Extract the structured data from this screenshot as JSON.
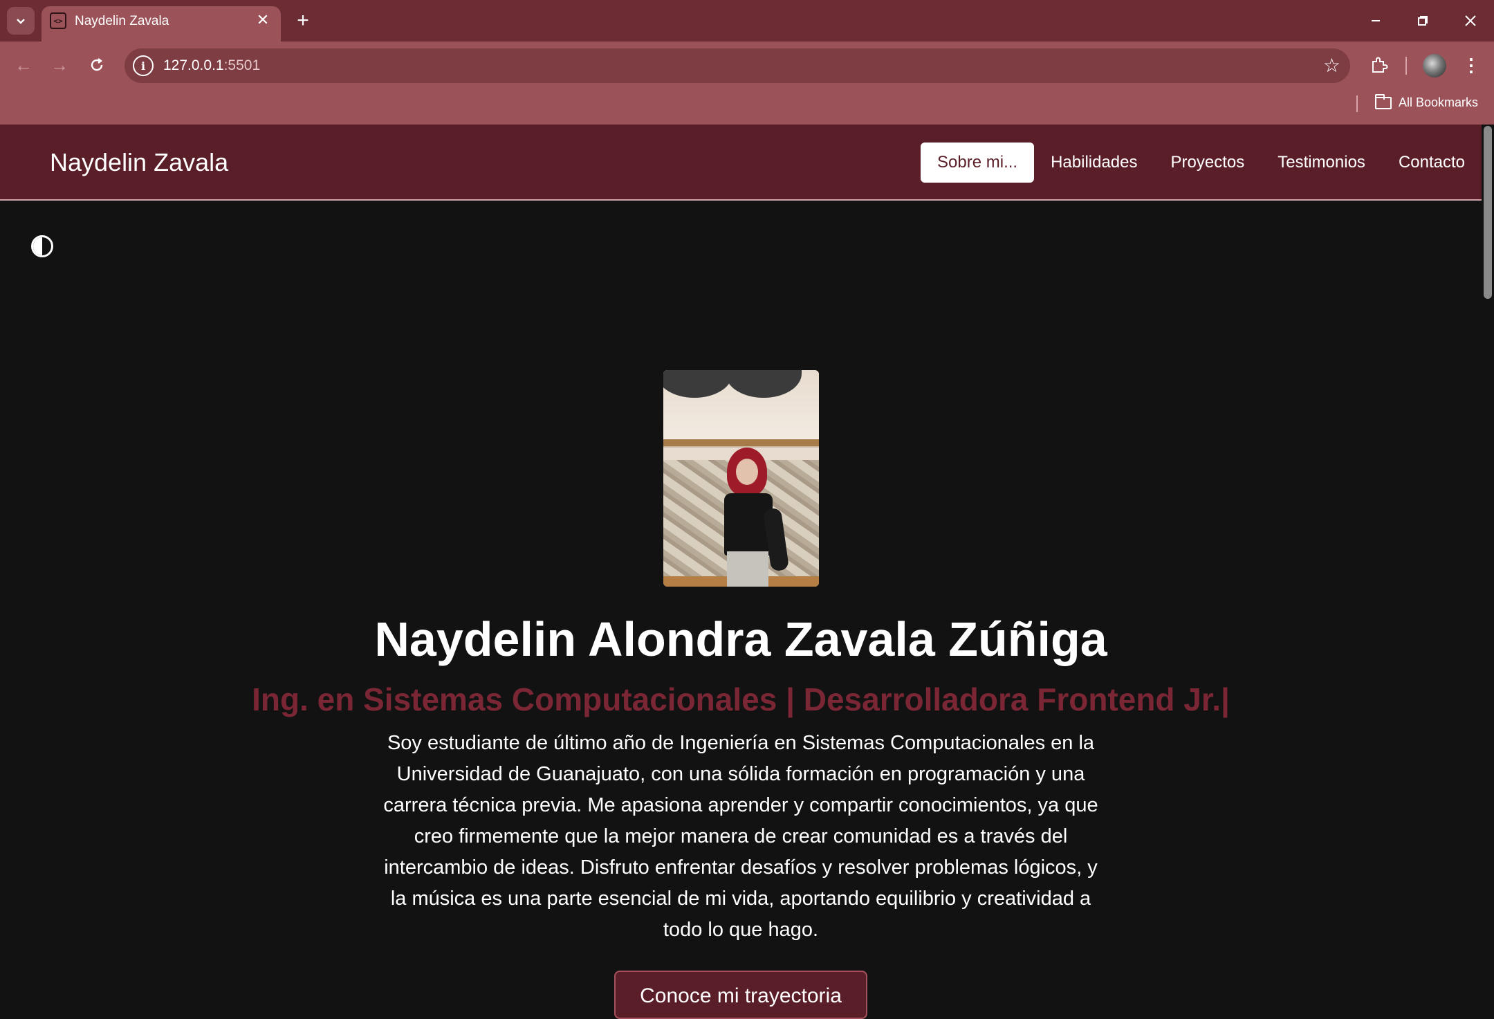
{
  "browser": {
    "tab_title": "Naydelin Zavala",
    "url_host": "127.0.0.1",
    "url_port": ":5501",
    "bookmarks_label": "All Bookmarks"
  },
  "nav": {
    "brand": "Naydelin Zavala",
    "links": [
      "Sobre mi...",
      "Habilidades",
      "Proyectos",
      "Testimonios",
      "Contacto"
    ],
    "active_link": "Sobre mi..."
  },
  "hero": {
    "name": "Naydelin Alondra Zavala Zúñiga",
    "role": "Ing. en Sistemas Computacionales | Desarrolladora Frontend Jr.|",
    "bio": "Soy estudiante de último año de Ingeniería en Sistemas Computacionales en la Universidad de Guanajuato, con una sólida formación en programación y una carrera técnica previa. Me apasiona aprender y compartir conocimientos, ya que creo firmemente que la mejor manera de crear comunidad es a través del intercambio de ideas. Disfruto enfrentar desafíos y resolver problemas lógicos, y la música es una parte esencial de mi vida, aportando equilibrio y creatividad a todo lo que hago.",
    "cta": "Conoce mi trayectoria"
  },
  "colors": {
    "accent": "#5a1e28",
    "role_text": "#7a2634",
    "background": "#121212"
  },
  "icons": [
    "tab-search-icon",
    "code-favicon-icon",
    "close-icon",
    "plus-icon",
    "minimize-icon",
    "restore-icon",
    "back-arrow-icon",
    "forward-arrow-icon",
    "reload-icon",
    "site-info-icon",
    "star-icon",
    "extensions-icon",
    "profile-avatar",
    "kebab-menu-icon",
    "folder-icon",
    "theme-toggle-icon"
  ]
}
